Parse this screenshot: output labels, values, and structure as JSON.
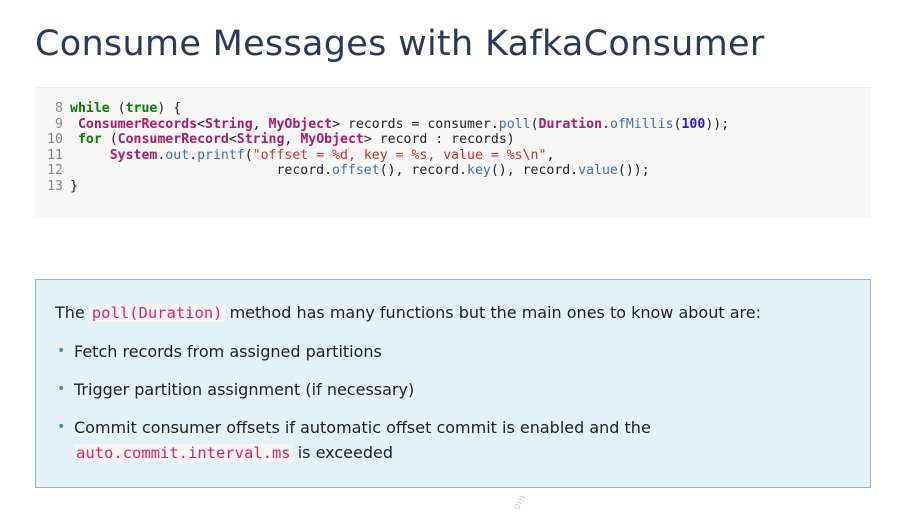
{
  "slide": {
    "title": "Consume Messages with KafkaConsumer"
  },
  "code": {
    "line_numbers": [
      "8",
      "9",
      "10",
      "11",
      "12",
      "13"
    ],
    "l8": {
      "kw_while": "while",
      "paren_open": " (",
      "kw_true": "true",
      "rest": ") {"
    },
    "l9": {
      "indent": " ",
      "t1": "ConsumerRecords",
      "p1": "<",
      "t2": "String",
      "p2": ", ",
      "t3": "MyObject",
      "p3": "> records = consumer.",
      "m1": "poll",
      "p4": "(",
      "t4": "Duration",
      "p5": ".",
      "m2": "ofMillis",
      "p6": "(",
      "n1": "100",
      "p7": "));"
    },
    "l10": {
      "indent": " ",
      "kw_for": "for",
      "p1": " (",
      "t1": "ConsumerRecord",
      "p2": "<",
      "t2": "String",
      "p3": ", ",
      "t3": "MyObject",
      "p4": "> record : records)"
    },
    "l11": {
      "indent": "     ",
      "t1": "System",
      "p1": ".",
      "m1": "out",
      "p2": ".",
      "m2": "printf",
      "p3": "(",
      "s1": "\"offset = %d, key = %s, value = %s\\n\"",
      "p4": ","
    },
    "l12": {
      "indent": "                          ",
      "p1": "record.",
      "m1": "offset",
      "p2": "(), record.",
      "m2": "key",
      "p3": "(), record.",
      "m3": "value",
      "p4": "());"
    },
    "l13": {
      "rest": "}"
    }
  },
  "info": {
    "intro_before": "The ",
    "intro_code": "poll(Duration)",
    "intro_after": " method has many functions but the main ones to know about are:",
    "bullets": [
      {
        "text": "Fetch records from assigned partitions"
      },
      {
        "text": "Trigger partition assignment (if necessary)"
      },
      {
        "text": "Commit consumer offsets if automatic offset commit is enabled and the",
        "code": "auto.commit.interval.ms",
        "after": " is exceeded"
      }
    ],
    "bullet_glyph": "•"
  },
  "colors": {
    "title": "#2a3a5c",
    "keyword": "#008000",
    "type": "#aa1a6f",
    "method": "#3d6fb0",
    "string": "#c8302a",
    "number": "#2a1ad8",
    "info_bg": "#e3f1f8",
    "info_border": "#8fb7cc",
    "inline_code": "#e0245e"
  },
  "watermark": "om"
}
